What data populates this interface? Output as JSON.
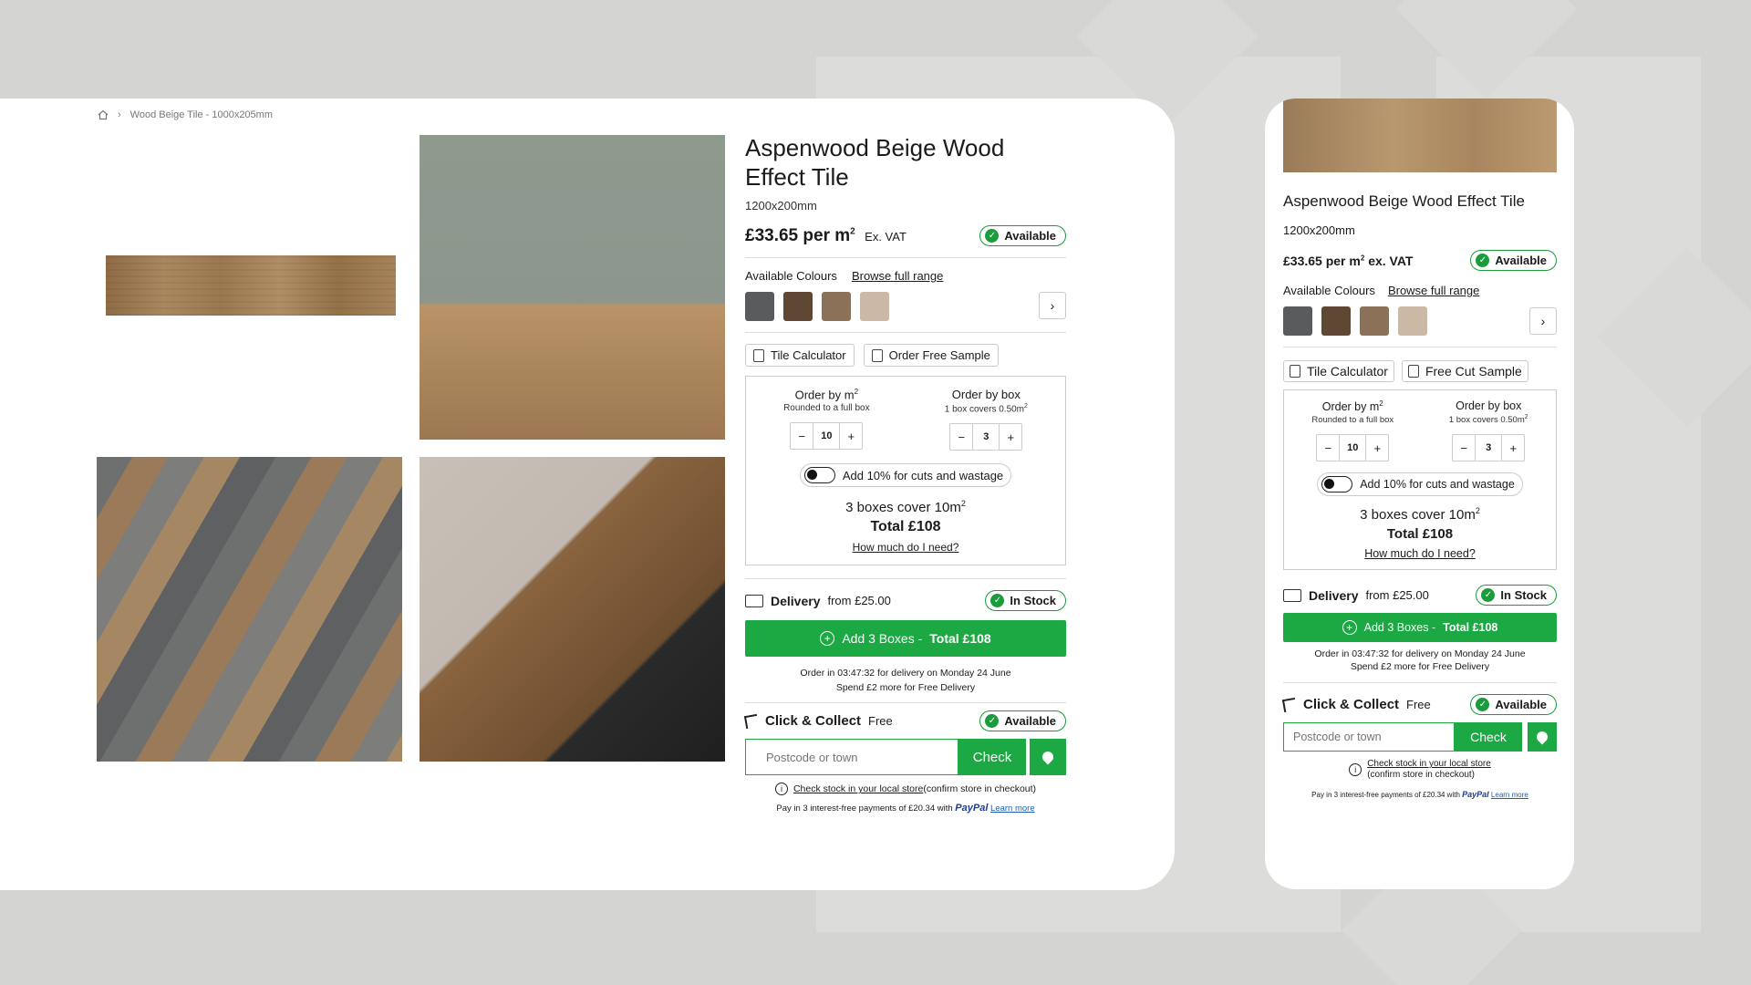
{
  "breadcrumb": {
    "current": "Wood Beige Tile - 1000x205mm"
  },
  "product": {
    "title": "Aspenwood Beige Wood Effect Tile",
    "size": "1200x200mm",
    "price": "£33.65 per m",
    "price_unit_sup": "2",
    "ex_vat": "Ex. VAT",
    "availability": "Available",
    "colours_label": "Available Colours",
    "browse_range": "Browse full range",
    "swatch_colors": [
      "#5a5b5c",
      "#5e4733",
      "#8a7158",
      "#cbb9a6"
    ],
    "tool_calculator": "Tile Calculator",
    "tool_sample_desktop": "Order Free Sample",
    "tool_sample_mobile": "Free Cut Sample"
  },
  "calculator": {
    "by_m2_title": "Order by m",
    "by_m2_sub": "Rounded to a full box",
    "by_box_title": "Order by box",
    "by_box_sub": "1 box covers 0.50m",
    "m2_value": "10",
    "box_value": "3",
    "minus": "−",
    "plus": "+",
    "wastage": "Add 10% for cuts and wastage",
    "boxes_cover": "3 boxes cover 10m",
    "total": "Total £108",
    "how_much": "How much do I need?"
  },
  "delivery": {
    "label": "Delivery",
    "from": "from £25.00",
    "stock": "In Stock",
    "add_prefix": "Add 3 Boxes - ",
    "add_total": "Total £108",
    "order_line1": "Order in 03:47:32 for delivery on Monday 24 June",
    "order_line2": "Spend £2 more for Free Delivery"
  },
  "collect": {
    "label": "Click & Collect",
    "price": "Free",
    "availability": "Available",
    "postcode_placeholder": "Postcode or town",
    "check": "Check",
    "stock_link": "Check stock in your local store",
    "stock_note": "(confirm store in checkout)",
    "paypal_prefix": "Pay in 3 interest-free payments of £20.34 with",
    "paypal_brand": "PayPal",
    "learn_more": "Learn more"
  },
  "mobile": {
    "price": "£33.65 per m",
    "ex_vat": "ex. VAT"
  },
  "colors": {
    "accent": "#1ca943",
    "badge_border": "#1a9b3c"
  }
}
